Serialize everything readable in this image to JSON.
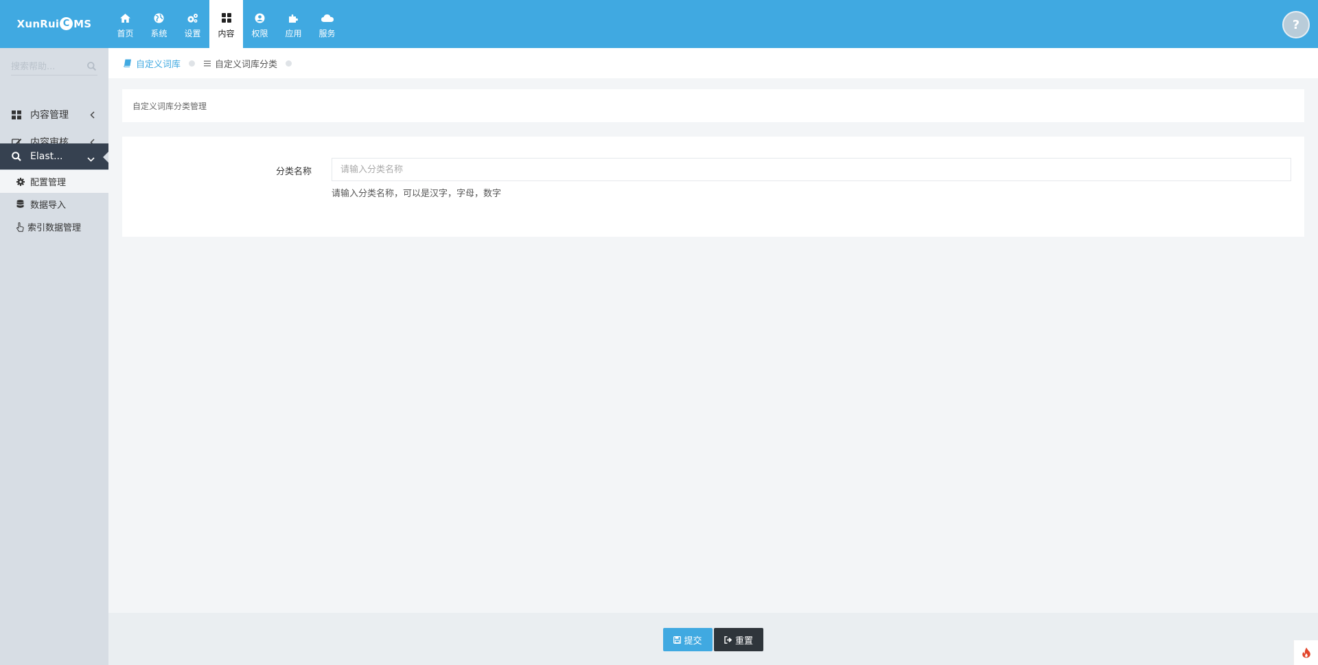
{
  "app": {
    "logo_pre": "XunRui",
    "logo_mark": "C",
    "logo_post": "MS",
    "help_mark": "?"
  },
  "nav": {
    "items": [
      {
        "label": "首页",
        "icon": "home-icon"
      },
      {
        "label": "系统",
        "icon": "globe-icon"
      },
      {
        "label": "设置",
        "icon": "cogs-icon"
      },
      {
        "label": "内容",
        "icon": "grid-icon",
        "active": true
      },
      {
        "label": "权限",
        "icon": "user-circle-icon"
      },
      {
        "label": "应用",
        "icon": "puzzle-icon"
      },
      {
        "label": "服务",
        "icon": "cloud-icon"
      }
    ]
  },
  "sidebar": {
    "search_placeholder": "搜索帮助...",
    "menus": [
      {
        "label": "内容管理",
        "icon": "grid-icon",
        "expanded": false
      },
      {
        "label": "内容审核",
        "icon": "edit-icon",
        "expanded": false
      },
      {
        "label": "Elast...",
        "icon": "search-icon",
        "expanded": true
      }
    ],
    "submenu": [
      {
        "label": "配置管理",
        "icon": "gear-icon",
        "current": true
      },
      {
        "label": "数据导入",
        "icon": "database-icon"
      },
      {
        "label": "索引数据管理",
        "icon": "hand-pointer-icon"
      }
    ]
  },
  "breadcrumb": {
    "parent": "自定义词库",
    "current": "自定义词库分类"
  },
  "panel": {
    "title": "自定义词库分类管理"
  },
  "form": {
    "label": "分类名称",
    "value": "",
    "placeholder": "请输入分类名称",
    "help": "请输入分类名称，可以是汉字，字母，数字"
  },
  "actions": {
    "submit": "提交",
    "reset": "重置"
  },
  "colors": {
    "primary": "#40a9e1",
    "sidebar_bg": "#d7dde4",
    "sidebar_active": "#364150",
    "dark_button": "#2f353b",
    "page_bg": "#f3f5f7"
  }
}
